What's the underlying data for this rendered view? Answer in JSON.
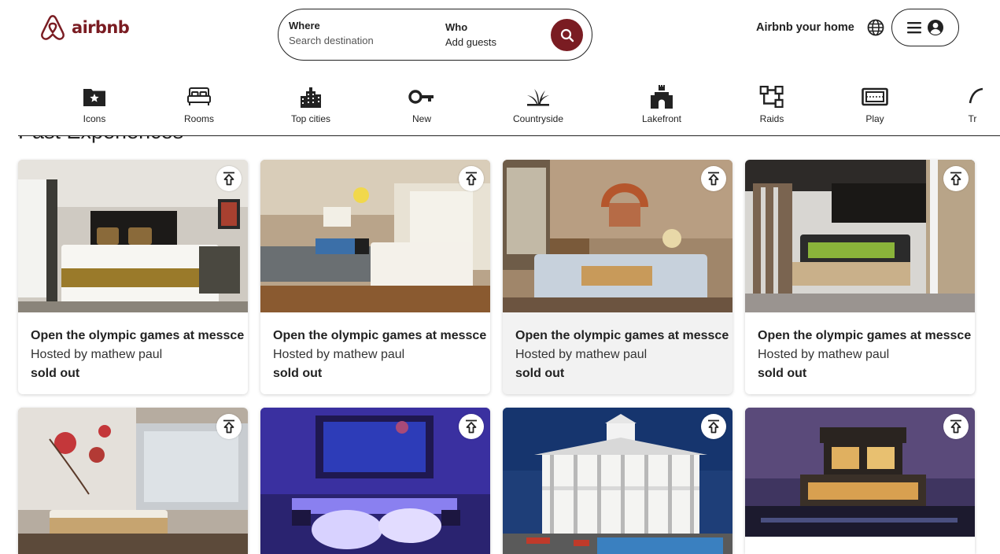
{
  "brand": {
    "name": "airbnb",
    "color": "#7a1c22"
  },
  "search": {
    "where_label": "Where",
    "where_placeholder": "Search destination",
    "who_label": "Who",
    "who_value": "Add guests",
    "button_icon": "search-icon"
  },
  "nav": {
    "host_link": "Airbnb your home",
    "language_icon": "globe-icon",
    "menu_icons": [
      "hamburger-icon",
      "user-circle-icon"
    ]
  },
  "categories": [
    {
      "label": "Icons",
      "icon": "star-folder-icon"
    },
    {
      "label": "Rooms",
      "icon": "bed-icon"
    },
    {
      "label": "Top cities",
      "icon": "city-buildings-icon"
    },
    {
      "label": "New",
      "icon": "key-icon"
    },
    {
      "label": "Countryside",
      "icon": "grass-icon"
    },
    {
      "label": "Lakefront",
      "icon": "castle-icon"
    },
    {
      "label": "Raids",
      "icon": "flowchart-icon"
    },
    {
      "label": "Play",
      "icon": "ticket-icon"
    },
    {
      "label": "Tr",
      "icon": "partial-icon"
    }
  ],
  "section_title": "Past Experiences",
  "listings": [
    {
      "title": "Open the olympic games at messce",
      "host": "Hosted by mathew paul",
      "status": "sold out",
      "image": "hotel-bedroom-photo"
    },
    {
      "title": "Open the olympic games at messce",
      "host": "Hosted by mathew paul",
      "status": "sold out",
      "image": "hotel-bedroom-photo"
    },
    {
      "title": "Open the olympic games at messce",
      "host": "Hosted by mathew paul",
      "status": "sold out",
      "image": "bedroom-mirror-photo"
    },
    {
      "title": "Open the olympic games at messce",
      "host": "Hosted by mathew paul",
      "status": "sold out",
      "image": "modern-bedroom-photo"
    },
    {
      "title": "",
      "host": "",
      "status": "",
      "image": "hotel-room-photo"
    },
    {
      "title": "",
      "host": "",
      "status": "",
      "image": "purple-bedroom-photo"
    },
    {
      "title": "",
      "host": "",
      "status": "",
      "image": "mansion-photo"
    },
    {
      "title": "",
      "host": "",
      "status": "",
      "image": "modern-house-night-photo"
    }
  ]
}
